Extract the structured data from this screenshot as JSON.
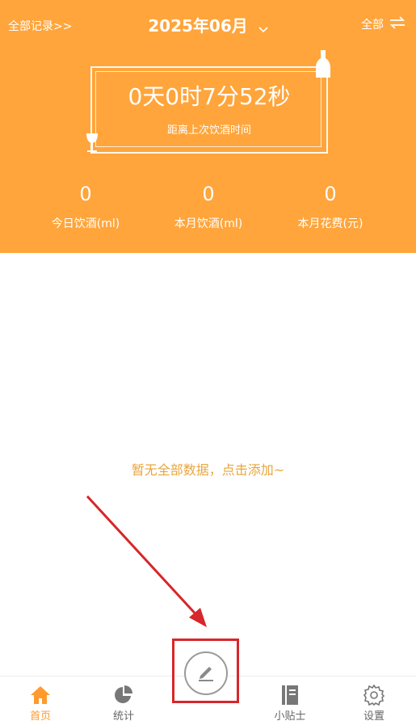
{
  "header": {
    "all_records": "全部记录>>",
    "month": "2025年06月",
    "filter": "全部",
    "timer": "0天0时7分52秒",
    "timer_label": "距离上次饮酒时间",
    "stats": [
      {
        "value": "0",
        "label": "今日饮酒(ml)"
      },
      {
        "value": "0",
        "label": "本月饮酒(ml)"
      },
      {
        "value": "0",
        "label": "本月花费(元)"
      }
    ]
  },
  "main": {
    "empty_text": "暂无全部数据，点击添加~"
  },
  "tabs": [
    {
      "label": "首页",
      "icon": "home-icon",
      "active": true
    },
    {
      "label": "统计",
      "icon": "pie-chart-icon",
      "active": false
    },
    {
      "label": "小贴士",
      "icon": "notebook-icon",
      "active": false
    },
    {
      "label": "设置",
      "icon": "gear-icon",
      "active": false
    }
  ],
  "colors": {
    "accent": "#ffa53b",
    "empty_text": "#e8a63c",
    "highlight": "#d7272a"
  }
}
